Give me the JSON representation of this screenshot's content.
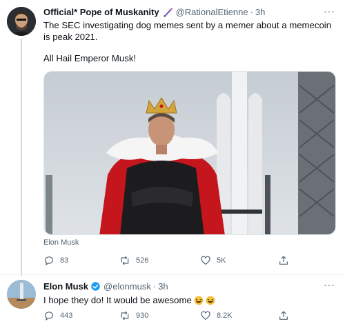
{
  "tweet1": {
    "display_name": "Official* Pope of Muskanity",
    "handle": "@RationalEtienne",
    "separator": "·",
    "time": "3h",
    "more": "···",
    "text_line1": "The SEC investigating dog memes sent by a memer about a memecoin is peak 2021.",
    "text_line2": "All Hail Emperor Musk!",
    "media_caption": "Elon Musk",
    "stats": {
      "replies": "83",
      "retweets": "526",
      "likes": "5K"
    }
  },
  "tweet2": {
    "display_name": "Elon Musk",
    "handle": "@elonmusk",
    "separator": "·",
    "time": "3h",
    "more": "···",
    "text": "I hope they do! It would be awesome",
    "stats": {
      "replies": "443",
      "retweets": "930",
      "likes": "8.2K"
    }
  },
  "icons": [
    "reply-icon",
    "retweet-icon",
    "like-icon",
    "share-icon",
    "verified-badge-icon",
    "pen-icon",
    "laughing-emoji-icon"
  ],
  "colors": {
    "accent": "#1d9bf0",
    "muted": "#536471",
    "text": "#0f1419",
    "cape": "#c4161c"
  }
}
